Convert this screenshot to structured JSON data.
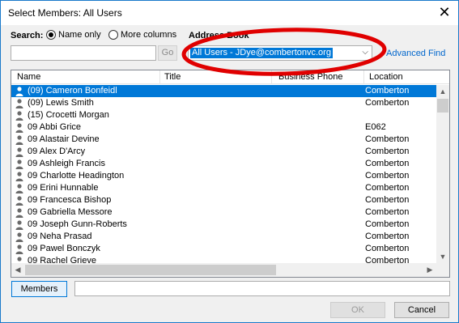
{
  "window": {
    "title": "Select Members: All Users",
    "close_glyph": "✕"
  },
  "search": {
    "label": "Search:",
    "options": [
      "Name only",
      "More columns"
    ],
    "selected": "Name only",
    "query": "",
    "go_label": "Go"
  },
  "address_book": {
    "label": "Address Book",
    "selected": "All Users - JDye@combertonvc.org",
    "advanced_find": "Advanced Find"
  },
  "table": {
    "headers": [
      "Name",
      "Title",
      "Business Phone",
      "Location"
    ],
    "rows": [
      {
        "name": "(09) Cameron Bonfeidl",
        "location": "Comberton",
        "selected": true
      },
      {
        "name": "(09) Lewis Smith",
        "location": "Comberton"
      },
      {
        "name": "(15) Crocetti Morgan",
        "location": ""
      },
      {
        "name": "09 Abbi Grice",
        "location": "E062"
      },
      {
        "name": "09 Alastair Devine",
        "location": "Comberton"
      },
      {
        "name": "09 Alex D'Arcy",
        "location": "Comberton"
      },
      {
        "name": "09 Ashleigh Francis",
        "location": "Comberton"
      },
      {
        "name": "09 Charlotte Headington",
        "location": "Comberton"
      },
      {
        "name": "09 Erini Hunnable",
        "location": "Comberton"
      },
      {
        "name": "09 Francesca Bishop",
        "location": "Comberton"
      },
      {
        "name": "09 Gabriella Messore",
        "location": "Comberton"
      },
      {
        "name": "09 Joseph Gunn-Roberts",
        "location": "Comberton"
      },
      {
        "name": "09 Neha Prasad",
        "location": "Comberton"
      },
      {
        "name": "09 Pawel Bonczyk",
        "location": "Comberton"
      },
      {
        "name": "09 Rachel Grieve",
        "location": "Comberton"
      }
    ]
  },
  "footer": {
    "members_label": "Members",
    "members_value": "",
    "ok_label": "OK",
    "cancel_label": "Cancel"
  },
  "colors": {
    "selection": "#0078d7",
    "highlight_ellipse": "#e00000",
    "link": "#0066cc"
  },
  "icons": {
    "row_icon": "person-icon"
  }
}
